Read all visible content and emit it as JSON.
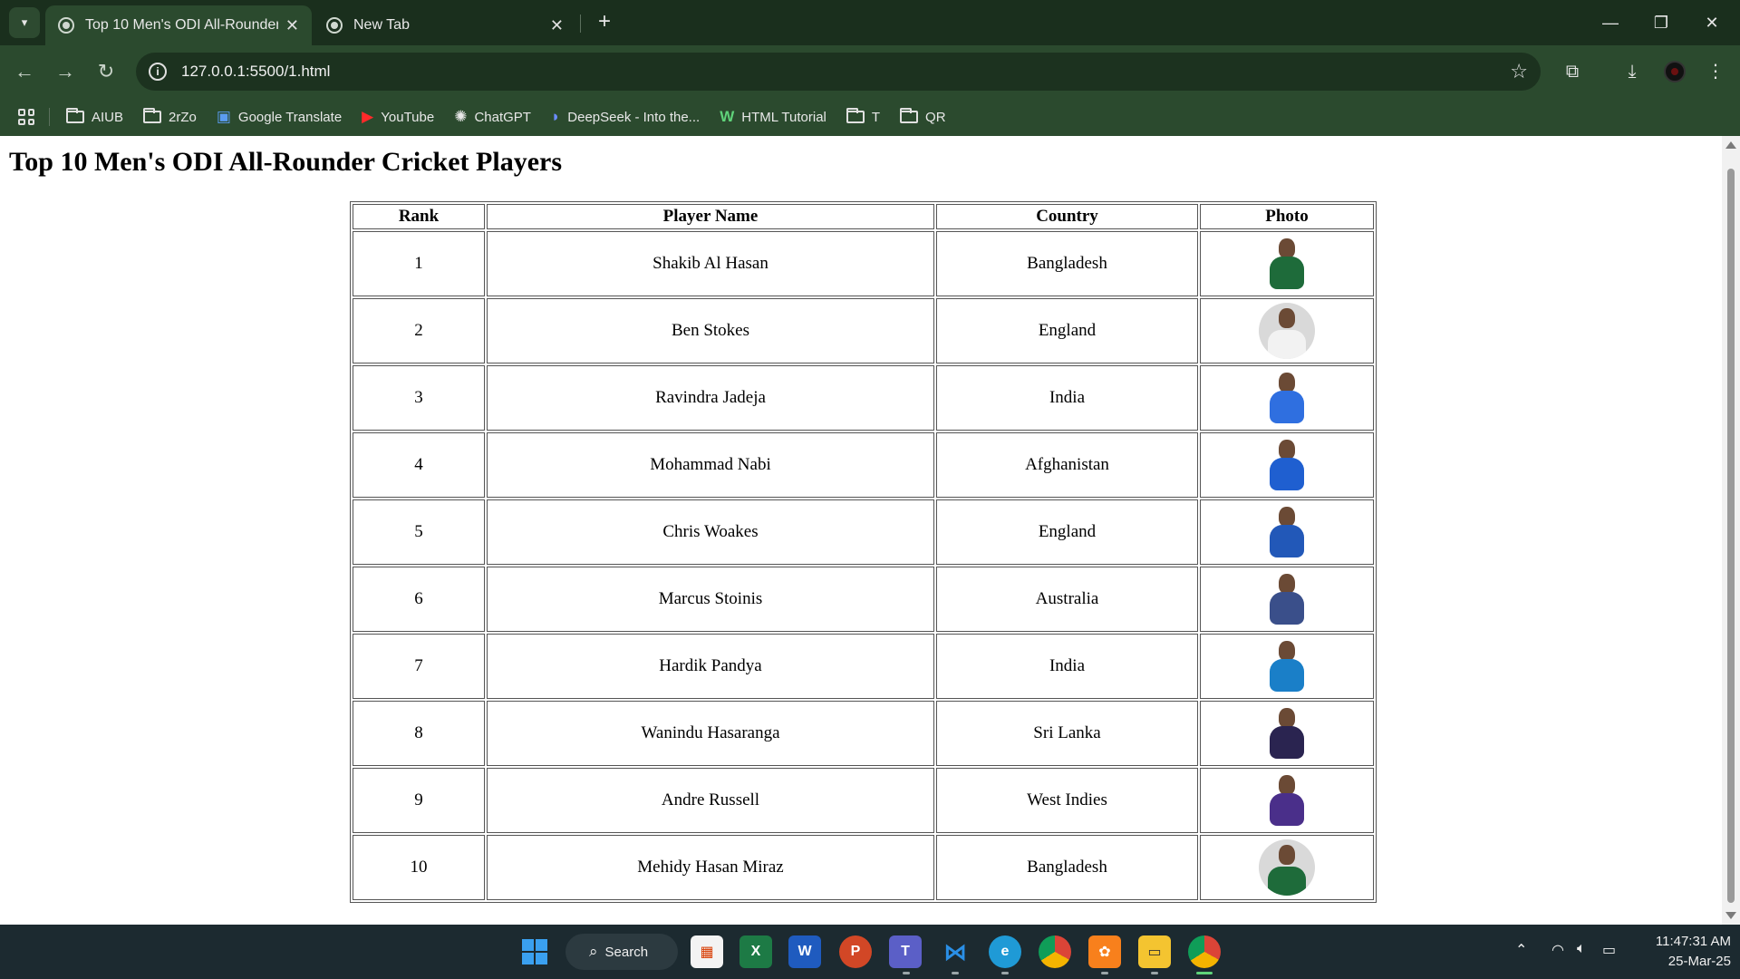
{
  "browser": {
    "tabs": [
      {
        "title": "Top 10 Men's ODI All-Rounder",
        "active": true
      },
      {
        "title": "New Tab",
        "active": false
      }
    ],
    "address": "127.0.0.1:5500/1.html",
    "bookmarks": [
      {
        "label": "AIUB",
        "icon": "folder-icon"
      },
      {
        "label": "2rZo",
        "icon": "folder-icon"
      },
      {
        "label": "Google Translate",
        "icon": "google-translate-icon"
      },
      {
        "label": "YouTube",
        "icon": "youtube-icon"
      },
      {
        "label": "ChatGPT",
        "icon": "chatgpt-icon"
      },
      {
        "label": "DeepSeek - Into the...",
        "icon": "deepseek-icon"
      },
      {
        "label": "HTML Tutorial",
        "icon": "w3schools-icon"
      },
      {
        "label": "T",
        "icon": "folder-icon"
      },
      {
        "label": "QR",
        "icon": "folder-icon"
      }
    ]
  },
  "page": {
    "heading": "Top 10 Men's ODI All-Rounder Cricket Players",
    "table": {
      "headers": [
        "Rank",
        "Player Name",
        "Country",
        "Photo"
      ],
      "rows": [
        {
          "rank": "1",
          "name": "Shakib Al Hasan",
          "country": "Bangladesh",
          "photo": {
            "jersey": "#1e6b3a",
            "round": false
          }
        },
        {
          "rank": "2",
          "name": "Ben Stokes",
          "country": "England",
          "photo": {
            "jersey": "#f2f2f2",
            "round": true
          }
        },
        {
          "rank": "3",
          "name": "Ravindra Jadeja",
          "country": "India",
          "photo": {
            "jersey": "#2f6fe0",
            "round": false
          }
        },
        {
          "rank": "4",
          "name": "Mohammad Nabi",
          "country": "Afghanistan",
          "photo": {
            "jersey": "#1f5fd0",
            "round": false
          }
        },
        {
          "rank": "5",
          "name": "Chris Woakes",
          "country": "England",
          "photo": {
            "jersey": "#2258b8",
            "round": false
          }
        },
        {
          "rank": "6",
          "name": "Marcus Stoinis",
          "country": "Australia",
          "photo": {
            "jersey": "#3a4f8a",
            "round": false
          }
        },
        {
          "rank": "7",
          "name": "Hardik Pandya",
          "country": "India",
          "photo": {
            "jersey": "#1a7fc8",
            "round": false
          }
        },
        {
          "rank": "8",
          "name": "Wanindu Hasaranga",
          "country": "Sri Lanka",
          "photo": {
            "jersey": "#2a2450",
            "round": false
          }
        },
        {
          "rank": "9",
          "name": "Andre Russell",
          "country": "West Indies",
          "photo": {
            "jersey": "#4a2f8a",
            "round": false
          }
        },
        {
          "rank": "10",
          "name": "Mehidy Hasan Miraz",
          "country": "Bangladesh",
          "photo": {
            "jersey": "#1e6b3a",
            "round": true
          }
        }
      ]
    }
  },
  "taskbar": {
    "search_label": "Search",
    "apps": [
      "microsoft-store-icon",
      "excel-icon",
      "word-icon",
      "powerpoint-icon",
      "teams-icon",
      "vscode-icon",
      "edge-icon",
      "chrome-icon",
      "xampp-icon",
      "file-explorer-icon",
      "chrome-active-icon"
    ],
    "time": "11:47:31 AM",
    "date": "25-Mar-25"
  }
}
